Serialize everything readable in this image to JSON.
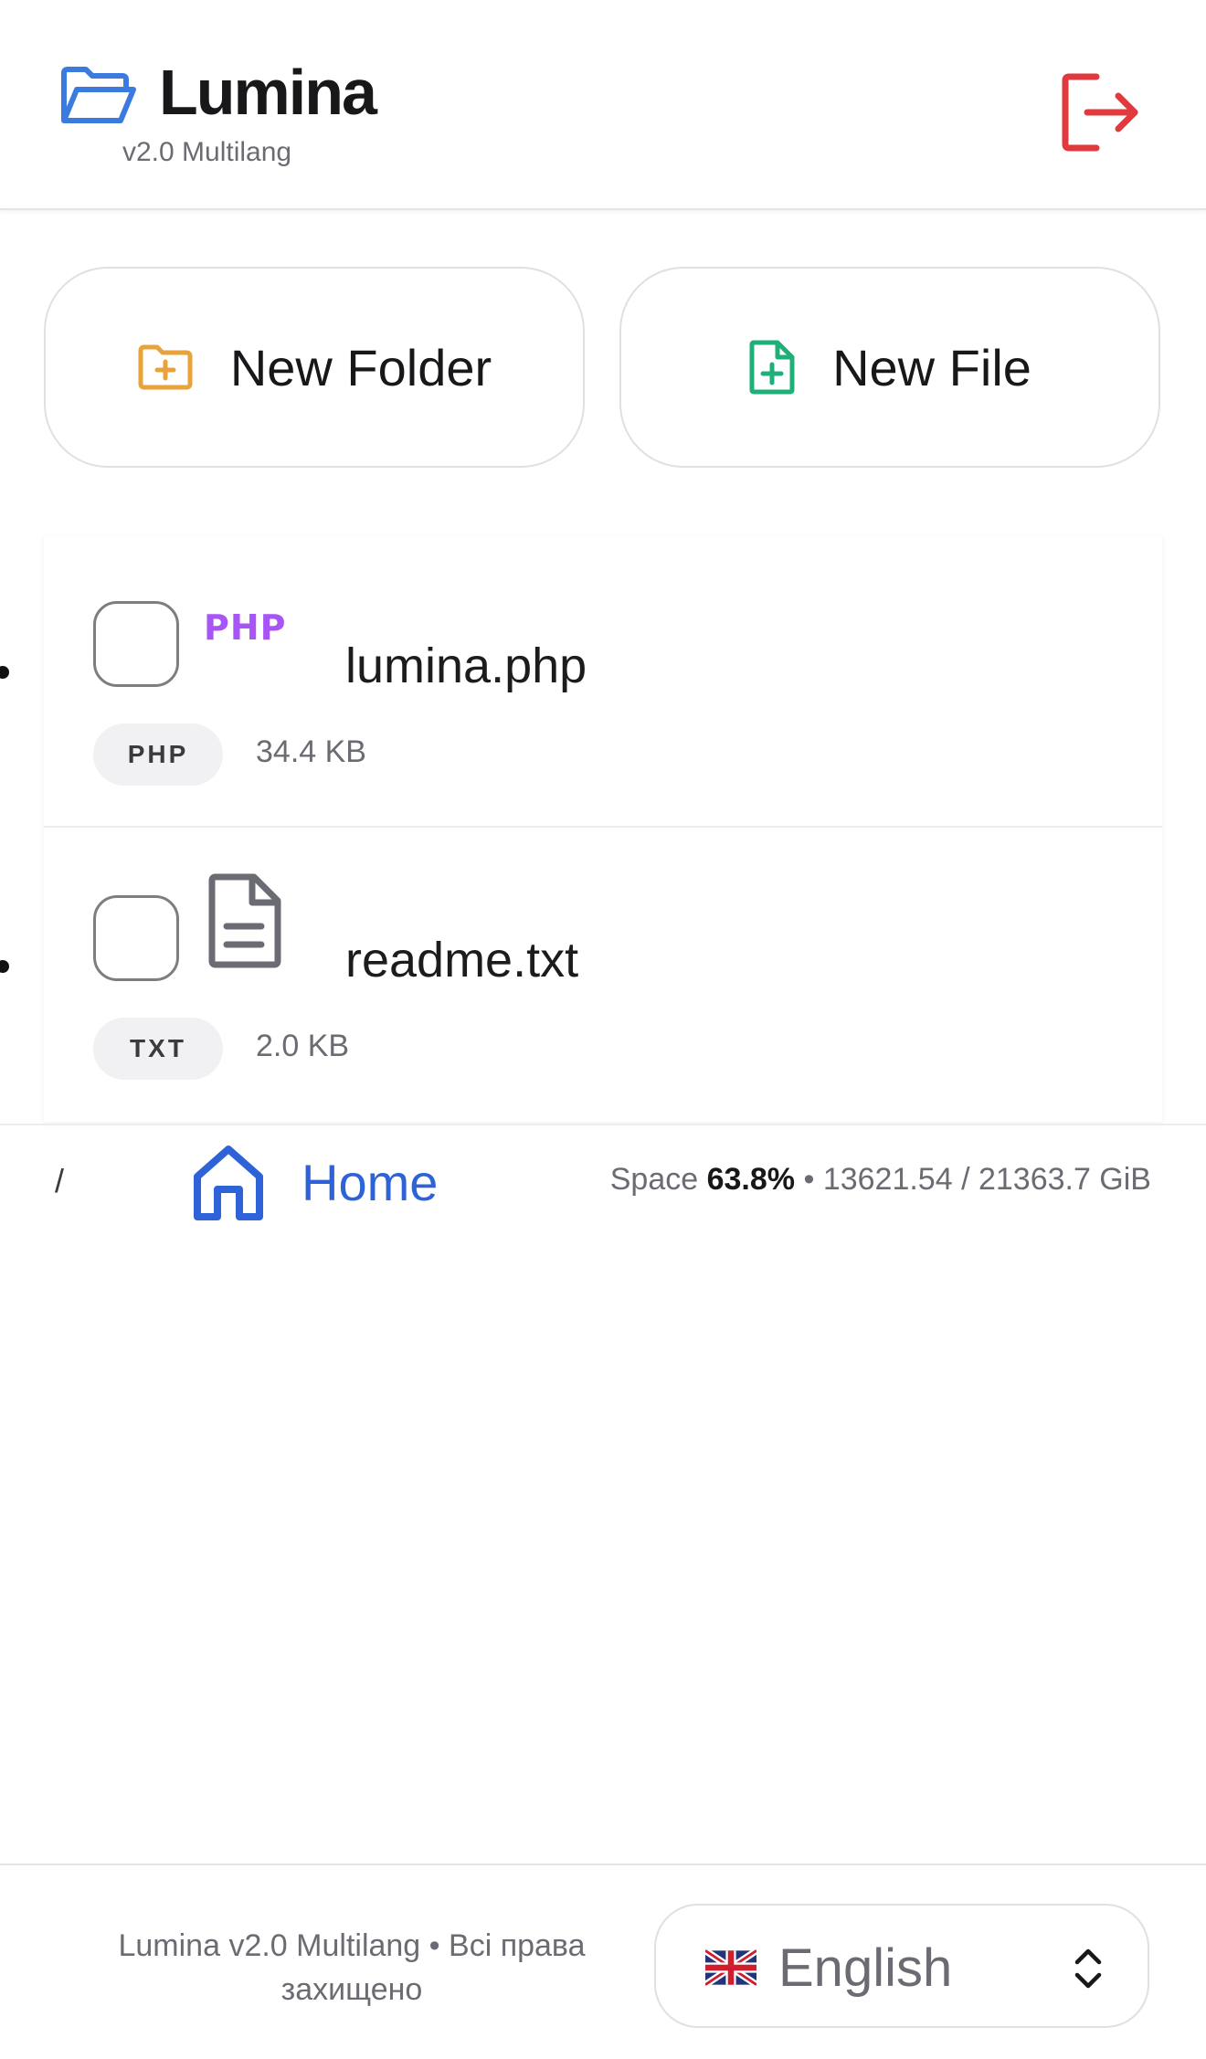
{
  "header": {
    "title": "Lumina",
    "subtitle": "v2.0 Multilang",
    "brand_icon": "folder-open-icon",
    "logout_icon": "logout-icon"
  },
  "actions": {
    "new_folder_label": "New Folder",
    "new_file_label": "New File"
  },
  "files": [
    {
      "name": "lumina.php",
      "icon_text": "PHP",
      "ext": "PHP",
      "size": "34.4 KB"
    },
    {
      "name": "readme.txt",
      "icon": "document-icon",
      "ext": "TXT",
      "size": "2.0 KB"
    }
  ],
  "breadcrumb": {
    "separator": "/",
    "home_label": "Home"
  },
  "storage": {
    "label": "Space",
    "percent": "63.8%",
    "sep": "•",
    "usage": "13621.54 / 21363.7 GiB"
  },
  "footer": {
    "copyright": "Lumina v2.0 Multilang • Всі права захищено",
    "language": "English"
  },
  "colors": {
    "accent_blue": "#2d62d8",
    "logout_red": "#e0393e",
    "folder_orange": "#e8a33a",
    "file_green": "#1fb07a",
    "php_purple": "#a855f7"
  }
}
